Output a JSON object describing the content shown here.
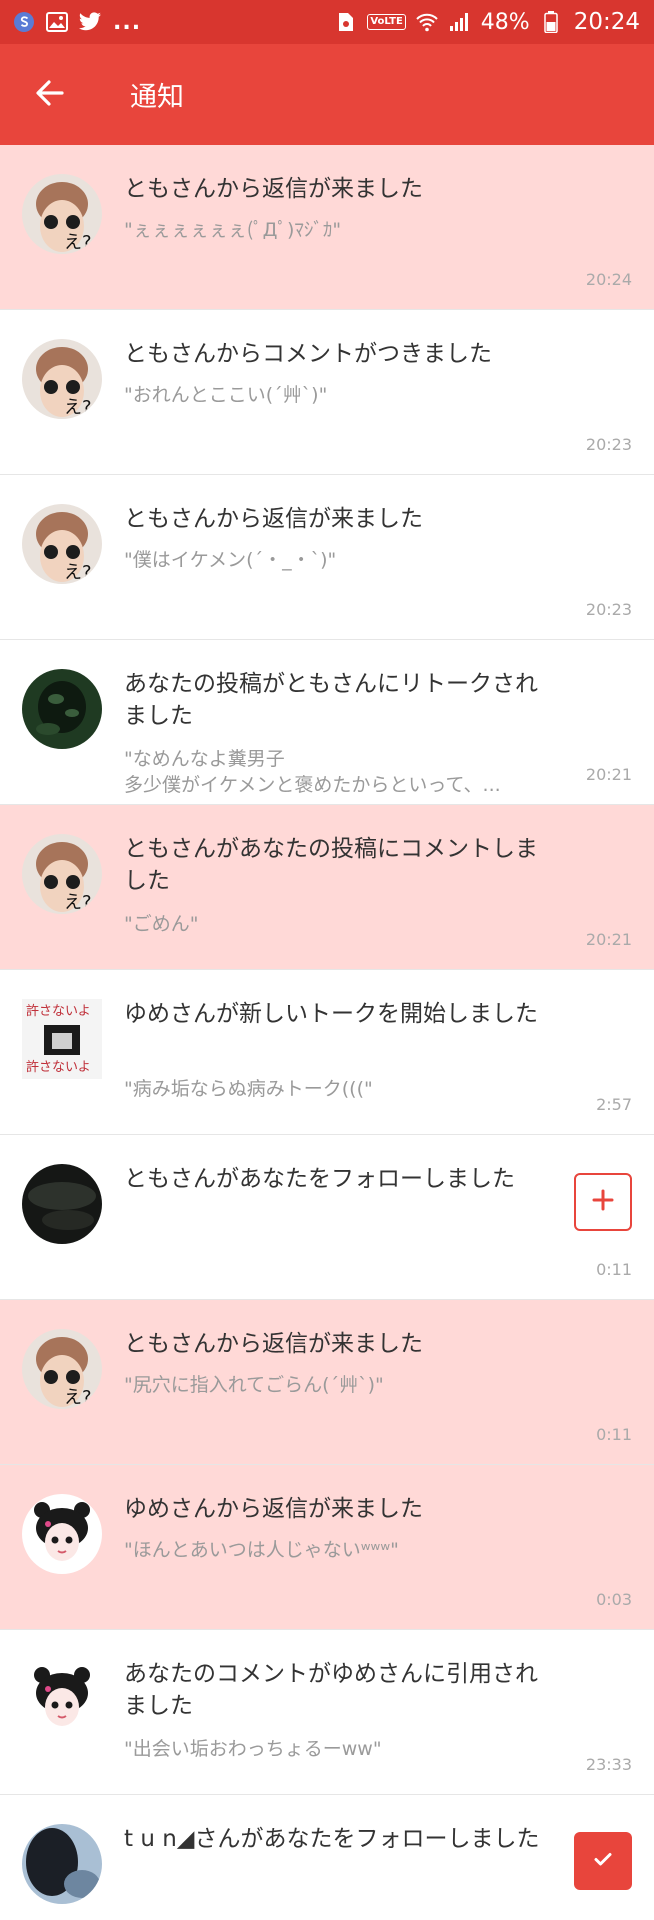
{
  "status_bar": {
    "battery_percent": "48%",
    "time": "20:24",
    "volte_label": "VoLTE",
    "overflow": "...",
    "icons": [
      "app-s-icon",
      "gallery-icon",
      "twitter-icon",
      "sim-icon",
      "volte-icon",
      "wifi-icon",
      "signal-icon",
      "battery-icon"
    ]
  },
  "header": {
    "title": "通知",
    "back_icon": "arrow-left-icon"
  },
  "colors": {
    "status_bar": "#d8362f",
    "app_bar": "#e8453c",
    "unread_row": "#ffd9d7",
    "accent": "#e8453c"
  },
  "notifications": [
    {
      "title": "ともさんから返信が来ました",
      "subtitle": "\"ぇぇぇぇぇぇ(ﾟДﾟ)ﾏｼﾞｶ\"",
      "time": "20:24",
      "unread": true
    },
    {
      "title": "ともさんからコメントがつきました",
      "subtitle": "\"おれんとここい(´艸`)\"",
      "time": "20:23",
      "unread": false
    },
    {
      "title": "ともさんから返信が来ました",
      "subtitle": "\"僕はイケメン(´・_・`)\"",
      "time": "20:23",
      "unread": false
    },
    {
      "title": "あなたの投稿がともさんにリトークされました",
      "subtitle": "\"なめんなよ糞男子\n多少僕がイケメンと褒めたからといって、...",
      "time": "20:21",
      "unread": false
    },
    {
      "title": "ともさんがあなたの投稿にコメントしました",
      "subtitle": "\"ごめん\"",
      "time": "20:21",
      "unread": true
    },
    {
      "title": "ゆめさんが新しいトークを開始しました",
      "subtitle": "\"病み垢ならぬ病みトーク(((\"",
      "time": "2:57",
      "unread": false,
      "avatar_text": "許さないよ"
    },
    {
      "title": "ともさんがあなたをフォローしました",
      "subtitle": "",
      "time": "0:11",
      "unread": false,
      "action": "follow",
      "action_icon": "plus-icon"
    },
    {
      "title": "ともさんから返信が来ました",
      "subtitle": "\"尻穴に指入れてごらん(´艸`)\"",
      "time": "0:11",
      "unread": true
    },
    {
      "title": "ゆめさんから返信が来ました",
      "subtitle": "\"ほんとあいつは人じゃないʷʷʷ\"",
      "time": "0:03",
      "unread": true
    },
    {
      "title": "あなたのコメントがゆめさんに引用されました",
      "subtitle": "\"出会い垢おわっちょるーww\"",
      "time": "23:33",
      "unread": false
    },
    {
      "title": "t u n◢さんがあなたをフォローしました",
      "subtitle": "",
      "time": "",
      "unread": false,
      "action": "followed",
      "action_icon": "check-icon"
    }
  ]
}
